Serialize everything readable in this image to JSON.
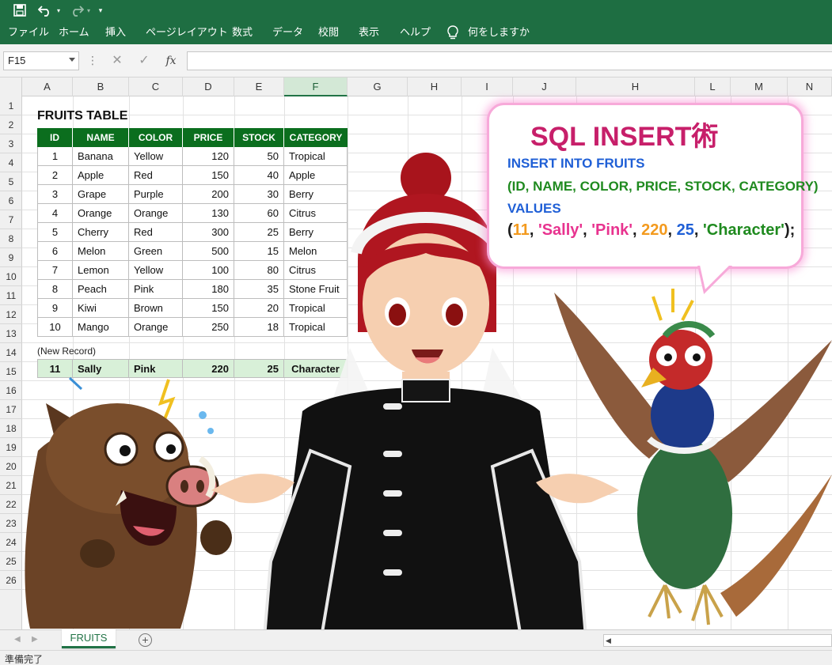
{
  "ribbon": {
    "tabs": [
      "ファイル",
      "ホーム",
      "挿入",
      "ページレイアウト",
      "数式",
      "データ",
      "校閲",
      "表示",
      "ヘルプ"
    ],
    "tell_me": "何をしますか"
  },
  "formula_bar": {
    "name_box": "F15",
    "cancel_symbol": "✕",
    "enter_symbol": "✓",
    "fx_label": "fx",
    "formula": ""
  },
  "grid": {
    "columns": [
      "A",
      "B",
      "C",
      "D",
      "E",
      "F",
      "G",
      "H",
      "I",
      "J",
      "H",
      "L",
      "M",
      "N"
    ],
    "active_column": "F",
    "rows": [
      "1",
      "2",
      "3",
      "4",
      "5",
      "6",
      "7",
      "8",
      "9",
      "10",
      "11",
      "12",
      "13",
      "14",
      "15",
      "16",
      "17",
      "18",
      "19",
      "20",
      "21",
      "22",
      "23",
      "24",
      "25",
      "26"
    ]
  },
  "table": {
    "title": "FRUITS TABLE",
    "headers": [
      "ID",
      "NAME",
      "COLOR",
      "PRICE",
      "STOCK",
      "CATEGORY"
    ],
    "rows": [
      [
        "1",
        "Banana",
        "Yellow",
        "120",
        "50",
        "Tropical"
      ],
      [
        "2",
        "Apple",
        "Red",
        "150",
        "40",
        "Apple"
      ],
      [
        "3",
        "Grape",
        "Purple",
        "200",
        "30",
        "Berry"
      ],
      [
        "4",
        "Orange",
        "Orange",
        "130",
        "60",
        "Citrus"
      ],
      [
        "5",
        "Cherry",
        "Red",
        "300",
        "25",
        "Berry"
      ],
      [
        "6",
        "Melon",
        "Green",
        "500",
        "15",
        "Melon"
      ],
      [
        "7",
        "Lemon",
        "Yellow",
        "100",
        "80",
        "Citrus"
      ],
      [
        "8",
        "Peach",
        "Pink",
        "180",
        "35",
        "Stone Fruit"
      ],
      [
        "9",
        "Kiwi",
        "Brown",
        "150",
        "20",
        "Tropical"
      ],
      [
        "10",
        "Mango",
        "Orange",
        "250",
        "18",
        "Tropical"
      ]
    ],
    "new_record_label": "(New Record)",
    "new_record": [
      "11",
      "Sally",
      "Pink",
      "220",
      "25",
      "Character"
    ]
  },
  "bubble": {
    "title": "SQL INSERT術",
    "line1": "INSERT INTO FRUITS",
    "line2": "(ID, NAME, COLOR, PRICE, STOCK, CATEGORY)",
    "line3": "VALUES",
    "open_paren": "(",
    "v_id": "11",
    "sep1": ", ",
    "v_name": "'Sally'",
    "sep2": ", ",
    "v_color": "'Pink'",
    "sep3": ", ",
    "v_price": "220",
    "sep4": ", ",
    "v_stock": "25",
    "sep5": ", ",
    "v_category": "'Character'",
    "close": ");"
  },
  "sheet_tabs": {
    "active": "FRUITS",
    "add_symbol": "+"
  },
  "status": {
    "text": "準備完了"
  },
  "colors": {
    "ribbon_green": "#1e6e42",
    "header_green": "#0b6e1e",
    "new_row_fill": "#d8f0d8",
    "title_pink": "#c71f6a",
    "sql_blue": "#1f5fd6",
    "sql_green": "#1f8a1f",
    "val_orange": "#f39a1e",
    "val_pink": "#e8338f",
    "val_blue": "#1f5fd6",
    "val_green": "#1f8a1f"
  }
}
